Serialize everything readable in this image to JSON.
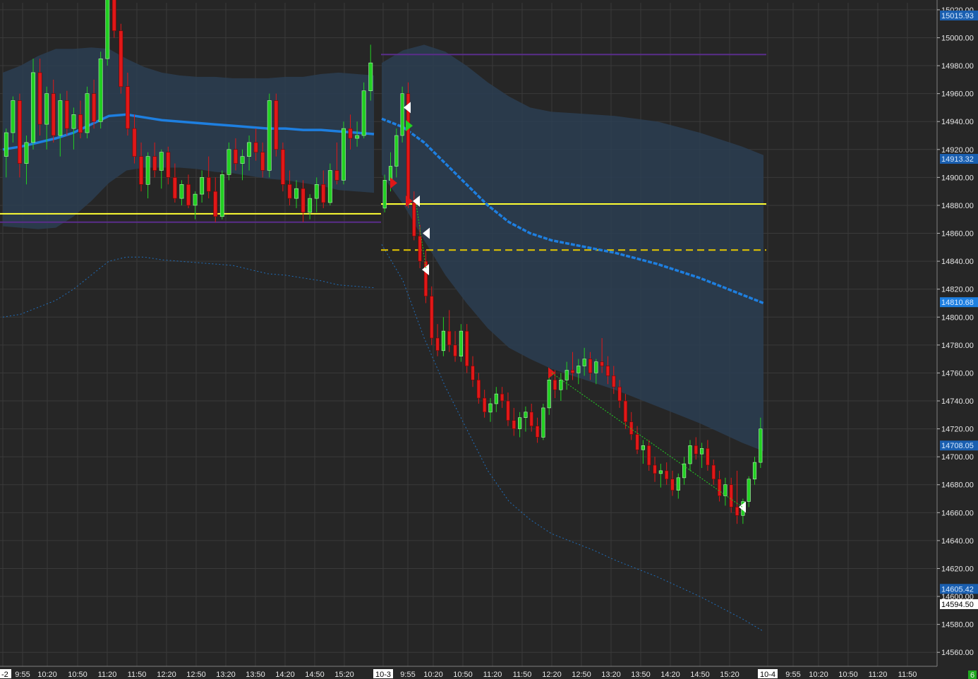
{
  "chart_data": {
    "type": "candlestick",
    "ylim": [
      14550,
      15025
    ],
    "y_ticks": [
      15020,
      15000,
      14980,
      14960,
      14940,
      14920,
      14900,
      14880,
      14860,
      14840,
      14820,
      14800,
      14780,
      14760,
      14740,
      14720,
      14700,
      14680,
      14660,
      14640,
      14620,
      14600,
      14580,
      14560
    ],
    "y_tick_labels": [
      "15020.00",
      "15000.00",
      "14980.00",
      "14960.00",
      "14940.00",
      "14920.00",
      "14900.00",
      "14880.00",
      "14860.00",
      "14840.00",
      "14820.00",
      "14800.00",
      "14780.00",
      "14760.00",
      "14740.00",
      "14720.00",
      "14700.00",
      "14680.00",
      "14660.00",
      "14640.00",
      "14620.00",
      "14600.00",
      "14580.00",
      "14560.00"
    ],
    "x_tick_labels": [
      "-2",
      "9:55",
      "10:20",
      "10:50",
      "11:20",
      "11:50",
      "12:20",
      "12:50",
      "13:20",
      "13:50",
      "14:20",
      "14:50",
      "15:20",
      "10-3",
      "9:55",
      "10:20",
      "10:50",
      "11:20",
      "11:50",
      "12:20",
      "12:50",
      "13:20",
      "13:50",
      "14:20",
      "14:50",
      "15:20",
      "10-4",
      "9:55",
      "10:20",
      "10:50",
      "11:20",
      "11:50"
    ],
    "x_tick_highlight": [
      "-2",
      "10-3",
      "10-4"
    ],
    "price_badges": [
      {
        "text": "15015.93",
        "value": 15015.93,
        "style": "blue"
      },
      {
        "text": "14913.32",
        "value": 14913.32,
        "style": "blue"
      },
      {
        "text": "14810.68",
        "value": 14810.68,
        "style": "blue-bright"
      },
      {
        "text": "14708.05",
        "value": 14708.05,
        "style": "blue"
      },
      {
        "text": "14605.42",
        "value": 14605.42,
        "style": "blue"
      },
      {
        "text": "14594.50",
        "value": 14594.5,
        "style": "white"
      }
    ],
    "corner_badge": "6",
    "levels": [
      {
        "name": "yellow-level-day1",
        "value": 14874,
        "color": "#ffff33",
        "style": "solid"
      },
      {
        "name": "yellow-level-day2",
        "value": 14881,
        "color": "#ffff33",
        "style": "solid"
      },
      {
        "name": "yellow-dashed-level",
        "value": 14848,
        "color": "#e6c800",
        "style": "dashed"
      },
      {
        "name": "purple-level-top",
        "value": 14988,
        "color": "#5a2d8a",
        "style": "solid"
      },
      {
        "name": "purple-level-day1",
        "value": 14868,
        "color": "#5a2d8a",
        "style": "solid"
      }
    ],
    "colors": {
      "background": "#262626",
      "grid": "#3a3a3a",
      "up": "#22d022",
      "down": "#e01818",
      "vwap": "#1e7fe0",
      "band": "#2c3e52",
      "band_outer": "#1e7fe0"
    },
    "sessions": [
      {
        "name": "day-1",
        "candles": [
          [
            14915,
            14935,
            14900,
            14932
          ],
          [
            14932,
            14958,
            14925,
            14955
          ],
          [
            14955,
            14960,
            14900,
            14910
          ],
          [
            14910,
            14930,
            14895,
            14925
          ],
          [
            14925,
            14985,
            14920,
            14975
          ],
          [
            14975,
            14985,
            14930,
            14938
          ],
          [
            14938,
            14965,
            14920,
            14960
          ],
          [
            14960,
            14970,
            14925,
            14930
          ],
          [
            14930,
            14960,
            14915,
            14955
          ],
          [
            14955,
            14962,
            14930,
            14935
          ],
          [
            14935,
            14950,
            14920,
            14945
          ],
          [
            14945,
            14955,
            14928,
            14932
          ],
          [
            14932,
            14965,
            14928,
            14960
          ],
          [
            14960,
            14970,
            14935,
            14940
          ],
          [
            14940,
            14990,
            14935,
            14985
          ],
          [
            14985,
            15040,
            14980,
            15035
          ],
          [
            15035,
            15040,
            15000,
            15005
          ],
          [
            15005,
            15010,
            14960,
            14965
          ],
          [
            14965,
            14975,
            14930,
            14935
          ],
          [
            14935,
            14945,
            14910,
            14915
          ],
          [
            14915,
            14925,
            14890,
            14895
          ],
          [
            14895,
            14918,
            14885,
            14915
          ],
          [
            14915,
            14925,
            14900,
            14905
          ],
          [
            14905,
            14920,
            14892,
            14918
          ],
          [
            14918,
            14922,
            14895,
            14900
          ],
          [
            14900,
            14910,
            14882,
            14885
          ],
          [
            14885,
            14898,
            14880,
            14895
          ],
          [
            14895,
            14902,
            14878,
            14880
          ],
          [
            14880,
            14890,
            14870,
            14888
          ],
          [
            14888,
            14905,
            14882,
            14900
          ],
          [
            14900,
            14915,
            14885,
            14890
          ],
          [
            14890,
            14900,
            14868,
            14872
          ],
          [
            14872,
            14905,
            14870,
            14902
          ],
          [
            14902,
            14925,
            14898,
            14920
          ],
          [
            14920,
            14928,
            14905,
            14910
          ],
          [
            14910,
            14920,
            14898,
            14915
          ],
          [
            14915,
            14930,
            14905,
            14925
          ],
          [
            14925,
            14935,
            14912,
            14918
          ],
          [
            14918,
            14925,
            14900,
            14905
          ],
          [
            14905,
            14960,
            14900,
            14955
          ],
          [
            14955,
            14960,
            14915,
            14920
          ],
          [
            14920,
            14925,
            14890,
            14895
          ],
          [
            14895,
            14905,
            14880,
            14885
          ],
          [
            14885,
            14898,
            14878,
            14892
          ],
          [
            14892,
            14898,
            14868,
            14875
          ],
          [
            14875,
            14888,
            14870,
            14885
          ],
          [
            14885,
            14900,
            14875,
            14895
          ],
          [
            14895,
            14905,
            14878,
            14882
          ],
          [
            14882,
            14910,
            14880,
            14905
          ],
          [
            14905,
            14925,
            14895,
            14898
          ],
          [
            14898,
            14940,
            14895,
            14935
          ],
          [
            14935,
            14945,
            14920,
            14928
          ],
          [
            14928,
            14940,
            14922,
            14930
          ],
          [
            14930,
            14968,
            14928,
            14962
          ],
          [
            14962,
            14995,
            14955,
            14982
          ]
        ]
      },
      {
        "name": "day-2",
        "candles": [
          [
            14878,
            14902,
            14875,
            14898
          ],
          [
            14898,
            14918,
            14890,
            14908
          ],
          [
            14908,
            14935,
            14900,
            14930
          ],
          [
            14930,
            14965,
            14925,
            14960
          ],
          [
            14960,
            14968,
            14878,
            14882
          ],
          [
            14882,
            14890,
            14855,
            14858
          ],
          [
            14858,
            14866,
            14835,
            14840
          ],
          [
            14840,
            14848,
            14810,
            14815
          ],
          [
            14815,
            14822,
            14780,
            14785
          ],
          [
            14785,
            14795,
            14772,
            14776
          ],
          [
            14776,
            14800,
            14772,
            14790
          ],
          [
            14790,
            14805,
            14775,
            14780
          ],
          [
            14780,
            14790,
            14768,
            14772
          ],
          [
            14772,
            14795,
            14768,
            14790
          ],
          [
            14790,
            14795,
            14760,
            14765
          ],
          [
            14765,
            14772,
            14750,
            14755
          ],
          [
            14755,
            14760,
            14738,
            14742
          ],
          [
            14742,
            14748,
            14728,
            14732
          ],
          [
            14732,
            14742,
            14725,
            14738
          ],
          [
            14738,
            14750,
            14732,
            14745
          ],
          [
            14745,
            14750,
            14735,
            14740
          ],
          [
            14740,
            14746,
            14722,
            14726
          ],
          [
            14726,
            14735,
            14715,
            14720
          ],
          [
            14720,
            14732,
            14714,
            14728
          ],
          [
            14728,
            14736,
            14718,
            14732
          ],
          [
            14732,
            14738,
            14718,
            14722
          ],
          [
            14722,
            14728,
            14710,
            14714
          ],
          [
            14714,
            14738,
            14712,
            14735
          ],
          [
            14735,
            14760,
            14730,
            14755
          ],
          [
            14755,
            14762,
            14742,
            14748
          ],
          [
            14748,
            14760,
            14740,
            14755
          ],
          [
            14755,
            14768,
            14748,
            14762
          ],
          [
            14762,
            14775,
            14755,
            14760
          ],
          [
            14760,
            14770,
            14752,
            14765
          ],
          [
            14765,
            14778,
            14758,
            14770
          ],
          [
            14770,
            14775,
            14755,
            14760
          ],
          [
            14760,
            14770,
            14752,
            14768
          ],
          [
            14768,
            14785,
            14760,
            14765
          ],
          [
            14765,
            14772,
            14752,
            14758
          ],
          [
            14758,
            14765,
            14745,
            14750
          ],
          [
            14750,
            14755,
            14735,
            14740
          ],
          [
            14740,
            14745,
            14720,
            14725
          ],
          [
            14725,
            14732,
            14712,
            14716
          ],
          [
            14716,
            14722,
            14702,
            14705
          ],
          [
            14705,
            14712,
            14695,
            14708
          ],
          [
            14708,
            14712,
            14690,
            14694
          ],
          [
            14694,
            14700,
            14682,
            14688
          ],
          [
            14688,
            14695,
            14678,
            14690
          ],
          [
            14690,
            14696,
            14680,
            14684
          ],
          [
            14684,
            14690,
            14672,
            14676
          ],
          [
            14676,
            14688,
            14670,
            14685
          ],
          [
            14685,
            14700,
            14680,
            14695
          ],
          [
            14695,
            14712,
            14690,
            14708
          ],
          [
            14708,
            14714,
            14698,
            14702
          ],
          [
            14702,
            14710,
            14692,
            14706
          ],
          [
            14706,
            14712,
            14690,
            14694
          ],
          [
            14694,
            14698,
            14680,
            14684
          ],
          [
            14684,
            14690,
            14668,
            14672
          ],
          [
            14672,
            14685,
            14665,
            14680
          ],
          [
            14680,
            14685,
            14660,
            14664
          ],
          [
            14664,
            14690,
            14652,
            14658
          ],
          [
            14658,
            14670,
            14652,
            14668
          ],
          [
            14668,
            14686,
            14664,
            14684
          ],
          [
            14684,
            14700,
            14680,
            14696
          ],
          [
            14696,
            14728,
            14692,
            14720
          ]
        ]
      }
    ],
    "vwap": [
      {
        "session": "day-1",
        "values": [
          14920,
          14922,
          14925,
          14928,
          14932,
          14938,
          14944,
          14945,
          14943,
          14941,
          14940,
          14939,
          14938,
          14937,
          14936,
          14935,
          14935,
          14934,
          14934,
          14933,
          14932,
          14931
        ]
      },
      {
        "session": "day-2",
        "values": [
          14942,
          14936,
          14925,
          14910,
          14895,
          14880,
          14868,
          14860,
          14855,
          14852,
          14849,
          14846,
          14842,
          14838,
          14833,
          14828,
          14822,
          14816,
          14810
        ]
      }
    ],
    "signals": [
      {
        "type": "sell",
        "color": "#ffffff",
        "value": 14950
      },
      {
        "type": "buy",
        "color": "#22d022",
        "value": 14937
      },
      {
        "type": "sell",
        "color": "#e01818",
        "value": 14896
      },
      {
        "type": "sell",
        "color": "#e01818",
        "value": 14883
      },
      {
        "type": "sell",
        "color": "#ffffff",
        "value": 14883
      },
      {
        "type": "sell",
        "color": "#ffffff",
        "value": 14860
      },
      {
        "type": "sell",
        "color": "#ffffff",
        "value": 14834
      },
      {
        "type": "sell",
        "color": "#e01818",
        "value": 14760
      },
      {
        "type": "sell",
        "color": "#ffffff",
        "value": 14664
      }
    ]
  }
}
